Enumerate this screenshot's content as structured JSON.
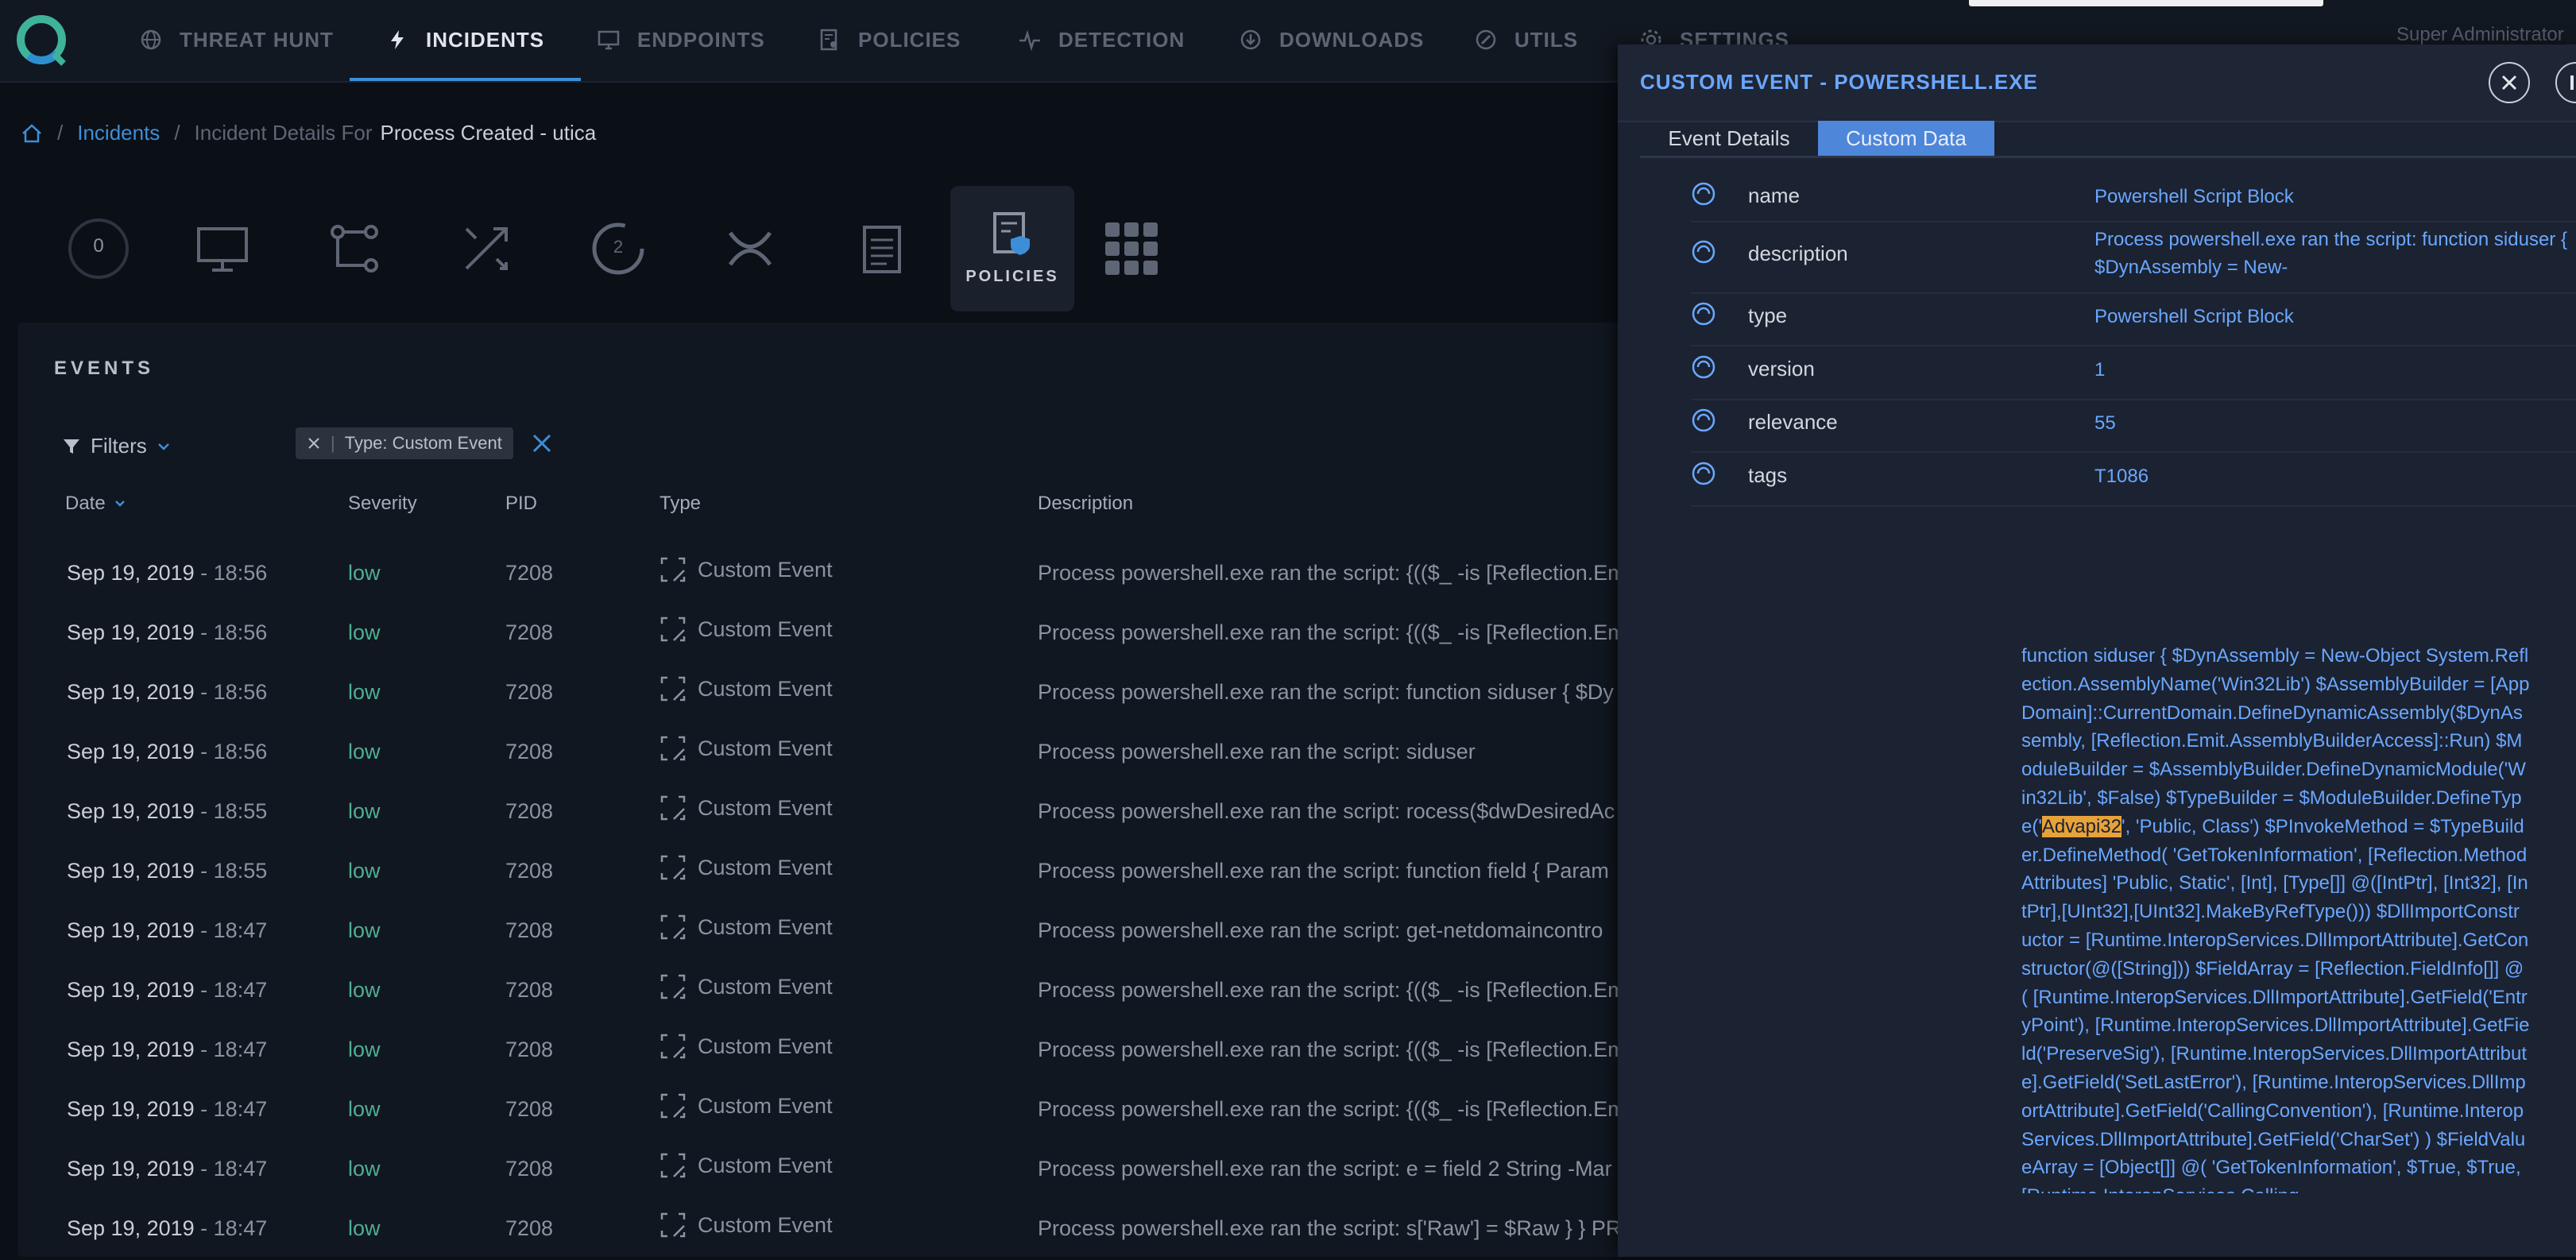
{
  "nav": {
    "items": [
      {
        "label": "THREAT HUNT",
        "icon": "globe-icon"
      },
      {
        "label": "INCIDENTS",
        "icon": "lightning-icon",
        "active": true
      },
      {
        "label": "ENDPOINTS",
        "icon": "monitor-icon"
      },
      {
        "label": "POLICIES",
        "icon": "policy-doc-icon"
      },
      {
        "label": "DETECTION",
        "icon": "pulse-icon"
      },
      {
        "label": "DOWNLOADS",
        "icon": "download-icon"
      },
      {
        "label": "UTILS",
        "icon": "tools-icon"
      },
      {
        "label": "SETTINGS",
        "icon": "gear-icon"
      }
    ],
    "user": "Super Administrator"
  },
  "breadcrumb": {
    "link": "Incidents",
    "prefix": "Incident Details For",
    "current": "Process Created - utica"
  },
  "iconbar": {
    "first_count": "0",
    "second_count": "2",
    "policies_label": "POLICIES"
  },
  "events": {
    "title": "EVENTS",
    "filters_label": "Filters",
    "chip": "Type: Custom Event",
    "headers": {
      "date": "Date",
      "severity": "Severity",
      "pid": "PID",
      "type": "Type",
      "description": "Description"
    },
    "rows": [
      {
        "date": "Sep 19, 2019",
        "time": "- 18:56",
        "severity": "low",
        "pid": "7208",
        "type": "Custom Event",
        "description": "Process powershell.exe ran the script: {(($_ -is [Reflection.Em"
      },
      {
        "date": "Sep 19, 2019",
        "time": "- 18:56",
        "severity": "low",
        "pid": "7208",
        "type": "Custom Event",
        "description": "Process powershell.exe ran the script: {(($_ -is [Reflection.Em"
      },
      {
        "date": "Sep 19, 2019",
        "time": "- 18:56",
        "severity": "low",
        "pid": "7208",
        "type": "Custom Event",
        "description": "Process powershell.exe ran the script: function siduser { $Dy"
      },
      {
        "date": "Sep 19, 2019",
        "time": "- 18:56",
        "severity": "low",
        "pid": "7208",
        "type": "Custom Event",
        "description": "Process powershell.exe ran the script: siduser"
      },
      {
        "date": "Sep 19, 2019",
        "time": "- 18:55",
        "severity": "low",
        "pid": "7208",
        "type": "Custom Event",
        "description": "Process powershell.exe ran the script: rocess($dwDesiredAc"
      },
      {
        "date": "Sep 19, 2019",
        "time": "- 18:55",
        "severity": "low",
        "pid": "7208",
        "type": "Custom Event",
        "description": "Process powershell.exe ran the script: function field { Param"
      },
      {
        "date": "Sep 19, 2019",
        "time": "- 18:47",
        "severity": "low",
        "pid": "7208",
        "type": "Custom Event",
        "description": "Process powershell.exe ran the script: get-netdomaincontro"
      },
      {
        "date": "Sep 19, 2019",
        "time": "- 18:47",
        "severity": "low",
        "pid": "7208",
        "type": "Custom Event",
        "description": "Process powershell.exe ran the script: {(($_ -is [Reflection.Em"
      },
      {
        "date": "Sep 19, 2019",
        "time": "- 18:47",
        "severity": "low",
        "pid": "7208",
        "type": "Custom Event",
        "description": "Process powershell.exe ran the script: {(($_ -is [Reflection.Em"
      },
      {
        "date": "Sep 19, 2019",
        "time": "- 18:47",
        "severity": "low",
        "pid": "7208",
        "type": "Custom Event",
        "description": "Process powershell.exe ran the script: {(($_ -is [Reflection.Em"
      },
      {
        "date": "Sep 19, 2019",
        "time": "- 18:47",
        "severity": "low",
        "pid": "7208",
        "type": "Custom Event",
        "description": "Process powershell.exe ran the script: e = field 2 String -Mar"
      },
      {
        "date": "Sep 19, 2019",
        "time": "- 18:47",
        "severity": "low",
        "pid": "7208",
        "type": "Custom Event",
        "description": "Process powershell.exe ran the script: s['Raw'] = $Raw } } PR"
      }
    ]
  },
  "drawer": {
    "title": "CUSTOM EVENT - POWERSHELL.EXE",
    "tabs": [
      "Event Details",
      "Custom Data"
    ],
    "properties": [
      {
        "name": "name",
        "value": "Powershell Script Block"
      },
      {
        "name": "description",
        "value": "Process powershell.exe ran the script: function siduser { $DynAssembly = New-"
      },
      {
        "name": "type",
        "value": "Powershell Script Block"
      },
      {
        "name": "version",
        "value": "1"
      },
      {
        "name": "relevance",
        "value": "55"
      },
      {
        "name": "tags",
        "value": "T1086"
      }
    ],
    "script_before": "function siduser { $DynAssembly = New-Object System.Reflection.AssemblyName('Win32Lib') $AssemblyBuilder = [AppDomain]::CurrentDomain.DefineDynamicAssembly($DynAssembly, [Reflection.Emit.AssemblyBuilderAccess]::Run) $ModuleBuilder = $AssemblyBuilder.DefineDynamicModule('Win32Lib', $False) $TypeBuilder = $ModuleBuilder.DefineType('",
    "script_highlight": "Advapi32",
    "script_after": "', 'Public, Class') $PInvokeMethod = $TypeBuilder.DefineMethod( 'GetTokenInformation', [Reflection.MethodAttributes] 'Public, Static', [Int], [Type[]] @([IntPtr], [Int32], [IntPtr],[UInt32],[UInt32].MakeByRefType())) $DllImportConstructor = [Runtime.InteropServices.DllImportAttribute].GetConstructor(@([String])) $FieldArray = [Reflection.FieldInfo[]] @( [Runtime.InteropServices.DllImportAttribute].GetField('EntryPoint'), [Runtime.InteropServices.DllImportAttribute].GetField('PreserveSig'), [Runtime.InteropServices.DllImportAttribute].GetField('SetLastError'), [Runtime.InteropServices.DllImportAttribute].GetField('CallingConvention'), [Runtime.InteropServices.DllImportAttribute].GetField('CharSet') ) $FieldValueArray = [Object[]] @( 'GetTokenInformation', $True, $True, [Runtime.InteropServices.Calling"
  },
  "colors": {
    "accent": "#3d8ed8",
    "link": "#6aa7ff",
    "severity_low": "#4fae92",
    "highlight": "#e8a23a"
  }
}
